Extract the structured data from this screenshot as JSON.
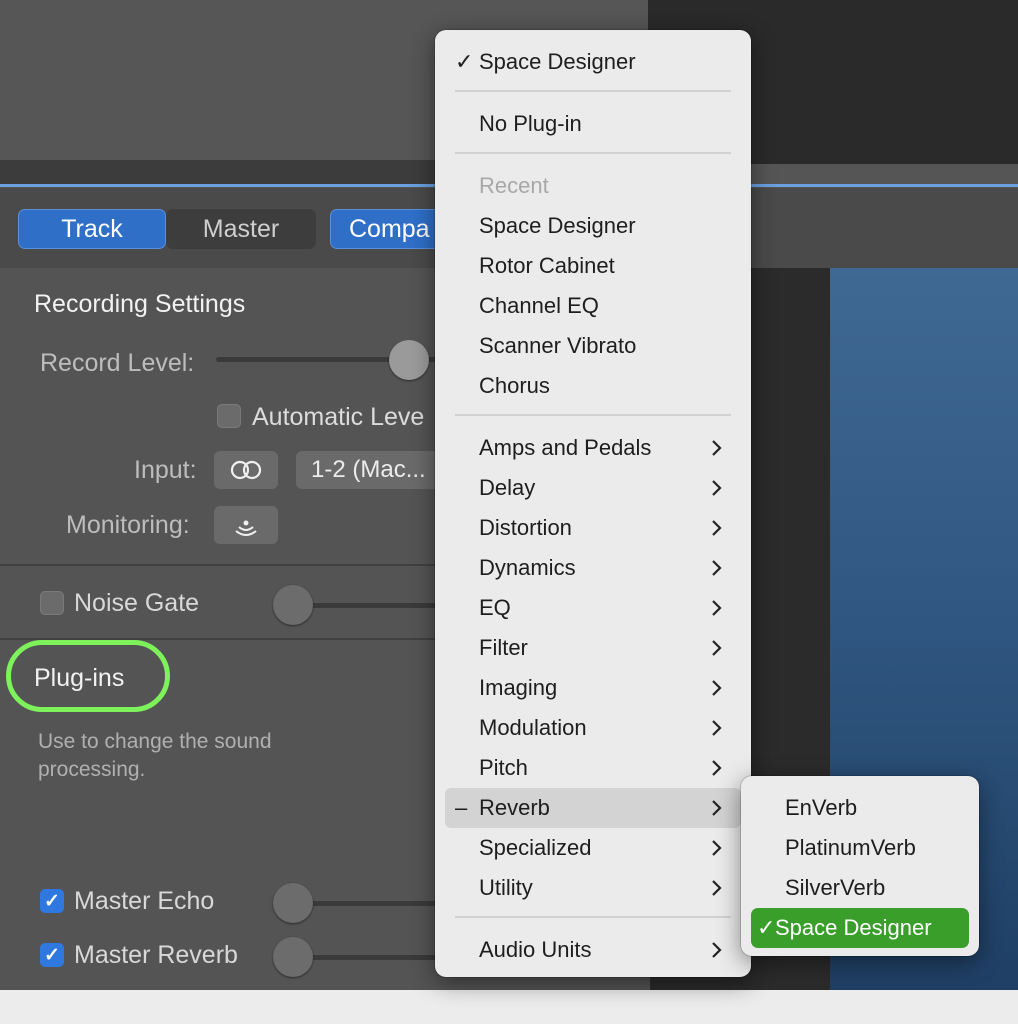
{
  "toolbar": {
    "tabs": [
      "Track",
      "Master",
      "Compa"
    ]
  },
  "inspector": {
    "recording_settings": "Recording Settings",
    "record_level": "Record Level:",
    "automatic_level": "Automatic Leve",
    "input_label": "Input:",
    "input_value": "1-2  (Mac...",
    "monitoring_label": "Monitoring:",
    "noise_gate": "Noise Gate",
    "plugins_title": "Plug-ins",
    "plugins_desc_line1": "Use to change the sound",
    "plugins_desc_line2": "processing.",
    "master_echo": "Master Echo",
    "master_reverb": "Master Reverb",
    "checked_mark": "✓"
  },
  "menu": {
    "current": "Space Designer",
    "check": "✓",
    "mixed": "–",
    "no_plugin": "No Plug-in",
    "recent_header": "Recent",
    "recent": [
      "Space Designer",
      "Rotor Cabinet",
      "Channel EQ",
      "Scanner Vibrato",
      "Chorus"
    ],
    "categories": [
      "Amps and Pedals",
      "Delay",
      "Distortion",
      "Dynamics",
      "EQ",
      "Filter",
      "Imaging",
      "Modulation",
      "Pitch",
      "Reverb",
      "Specialized",
      "Utility"
    ],
    "audio_units": "Audio Units"
  },
  "submenu": {
    "items": [
      "EnVerb",
      "PlatinumVerb",
      "SilverVerb",
      "Space Designer"
    ],
    "selected_color": "#3a9e2b"
  },
  "colors": {
    "highlight_ring": "#7df25a",
    "tab_blue": "#2f6fc8"
  }
}
